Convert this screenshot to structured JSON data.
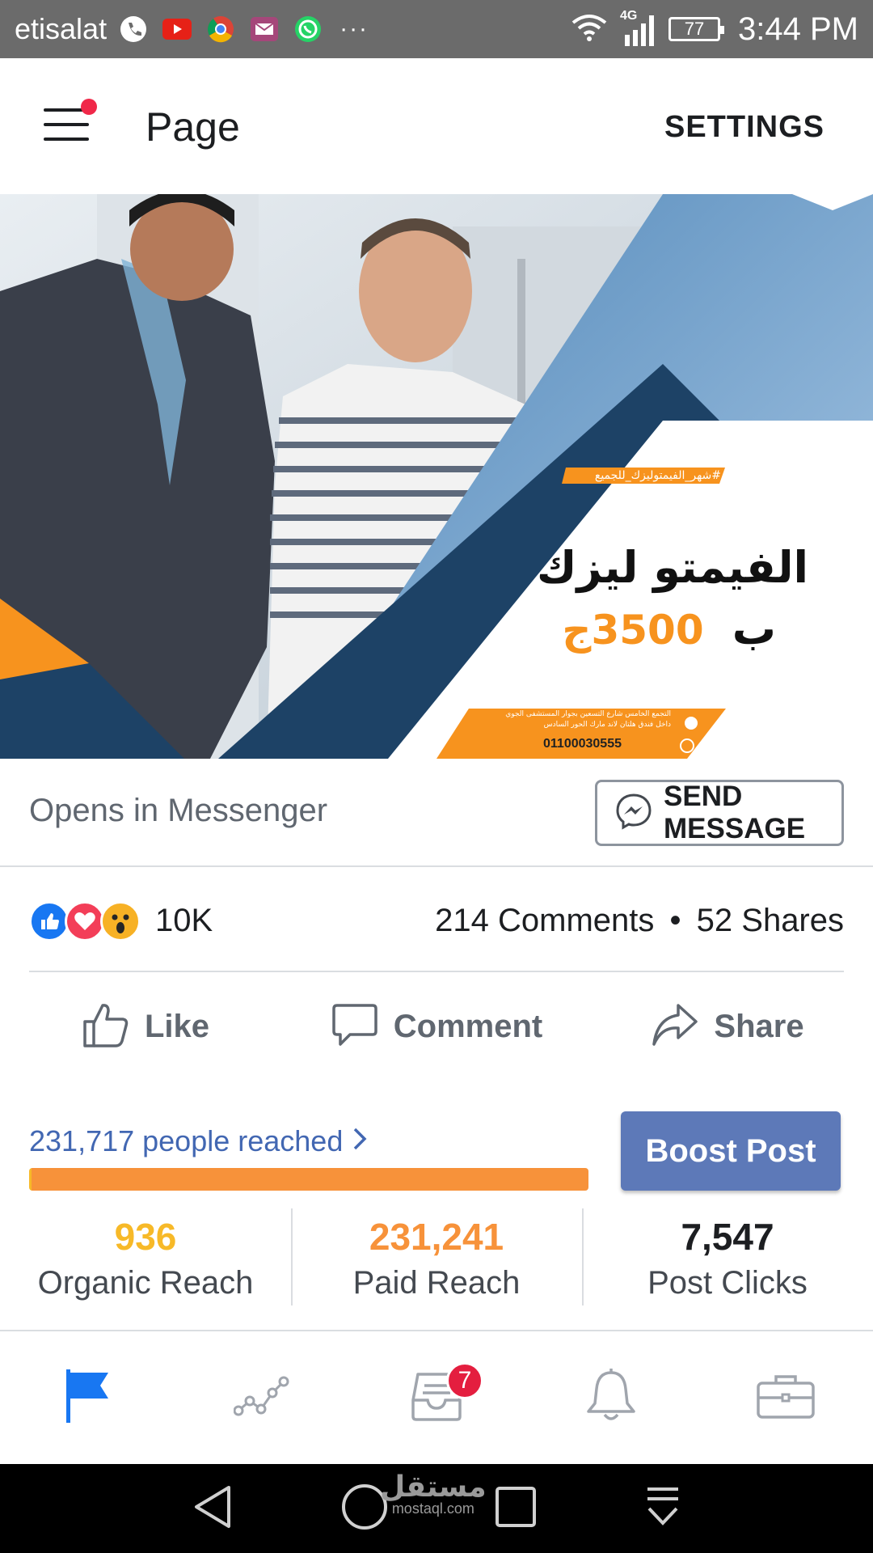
{
  "status_bar": {
    "carrier": "etisalat",
    "network": "4G",
    "battery": "77",
    "time": "3:44 PM",
    "overflow": "···"
  },
  "header": {
    "title": "Page",
    "settings_label": "SETTINGS"
  },
  "post": {
    "ad": {
      "hashtag": "#شهر_الفيمتوليزك_للجميع",
      "headline": "الفيمتو ليزك",
      "price_prefix": "ب",
      "price": "3500ج",
      "address_line1": "التجمع الخامس شارع التسعين بجوار المستشفى الجوي",
      "address_line2": "داخل فندق هلتان لاند مارك الحور السادس",
      "phone": "01100030555"
    },
    "messenger": {
      "label": "Opens in Messenger",
      "button_label": "SEND MESSAGE"
    },
    "reactions": {
      "count": "10K",
      "comments": "214 Comments",
      "separator": "•",
      "shares": "52 Shares",
      "types": [
        "like-icon",
        "love-icon",
        "wow-icon"
      ]
    },
    "actions": {
      "like": "Like",
      "comment": "Comment",
      "share": "Share"
    }
  },
  "insights": {
    "reached": "231,717 people reached",
    "boost_label": "Boost Post",
    "organic_share": 0.004,
    "stats": [
      {
        "value": "936",
        "label": "Organic Reach",
        "color": "#f7b928"
      },
      {
        "value": "231,241",
        "label": "Paid Reach",
        "color": "#f7923a"
      },
      {
        "value": "7,547",
        "label": "Post Clicks",
        "color": "#1c1e21"
      }
    ]
  },
  "tab_bar": {
    "inbox_badge": "7",
    "active_color": "#1877f2"
  },
  "watermark": {
    "arabic": "مستقل",
    "latin": "mostaql.com"
  }
}
